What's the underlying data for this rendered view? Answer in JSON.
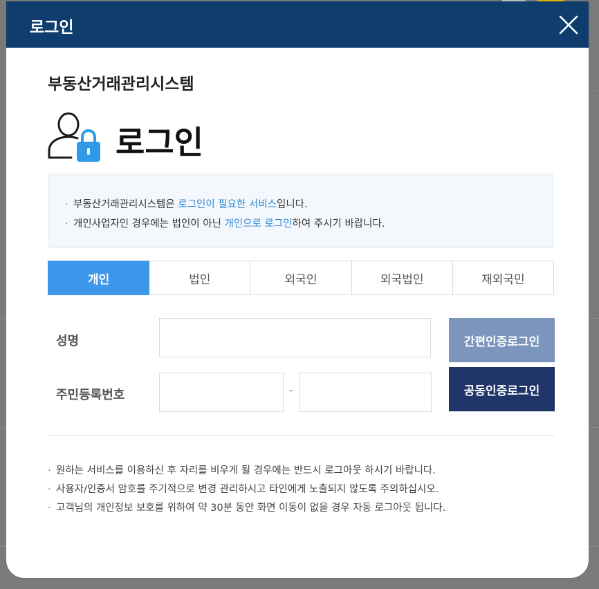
{
  "modal": {
    "header_title": "로그인",
    "system_title": "부동산거래관리시스템",
    "heading": "로그인",
    "close_icon": "close-icon",
    "user_icon": "user-lock-icon"
  },
  "notice": {
    "line1": {
      "pre": "부동산거래관리시스템은 ",
      "highlight": "로그인이 필요한 서비스",
      "post": "입니다."
    },
    "line2": {
      "pre": "개인사업자인 경우에는 법인이 아닌 ",
      "highlight": "개인으로 로그인",
      "post": "하여 주시기 바랍니다."
    }
  },
  "tabs": [
    {
      "label": "개인",
      "active": true
    },
    {
      "label": "법인",
      "active": false
    },
    {
      "label": "외국인",
      "active": false
    },
    {
      "label": "외국법인",
      "active": false
    },
    {
      "label": "재외국민",
      "active": false
    }
  ],
  "form": {
    "name_label": "성명",
    "name_value": "",
    "rrn_label": "주민등록번호",
    "rrn_front_value": "",
    "rrn_back_value": "",
    "rrn_separator": "-"
  },
  "buttons": {
    "simple_auth": "간편인증로그인",
    "cert_auth": "공동인증로그인"
  },
  "notes": [
    "원하는 서비스를 이용하신 후 자리를 비우게 될 경우에는 반드시 로그아웃 하시기 바랍니다.",
    "사용자/인증서 암호를 주기적으로 변경 관리하시고 타인에게 노출되지 않도록 주의하십시오.",
    "고객님의 개인정보 보호를 위하여 약 30분 동안 화면 이동이 없을 경우 자동 로그아웃 됩니다."
  ],
  "colors": {
    "header_bg": "#0f3e6e",
    "active_tab": "#3d97ea",
    "highlight_text": "#2d87d6",
    "simple_button": "#7b95bd",
    "cert_button": "#1f3468",
    "lock_icon": "#2f9be8"
  }
}
